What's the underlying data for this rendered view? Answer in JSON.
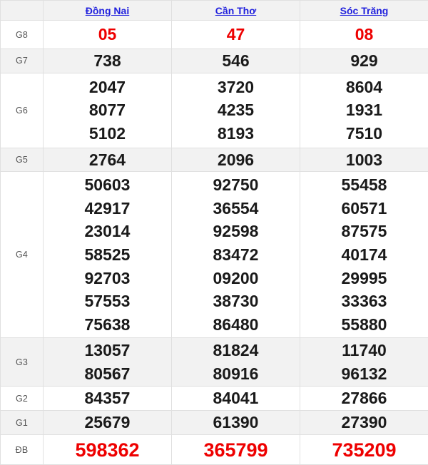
{
  "table": {
    "corner_label": "",
    "columns": [
      "Đồng Nai",
      "Cần Thơ",
      "Sóc Trăng"
    ],
    "colors": {
      "accent_red": "#ee0000",
      "link_blue": "#2222dd",
      "stripe_bg": "#f2f2f2",
      "plain_bg": "#ffffff",
      "border": "#e0e0e0",
      "number_black": "#1a1a1a",
      "label_gray": "#555555"
    },
    "rows": [
      {
        "label": "G8",
        "style": "plain",
        "accent": true,
        "size": "normal",
        "cells": [
          [
            "05"
          ],
          [
            "47"
          ],
          [
            "08"
          ]
        ]
      },
      {
        "label": "G7",
        "style": "stripe",
        "accent": false,
        "size": "normal",
        "cells": [
          [
            "738"
          ],
          [
            "546"
          ],
          [
            "929"
          ]
        ]
      },
      {
        "label": "G6",
        "style": "plain",
        "accent": false,
        "size": "normal",
        "cells": [
          [
            "2047",
            "8077",
            "5102"
          ],
          [
            "3720",
            "4235",
            "8193"
          ],
          [
            "8604",
            "1931",
            "7510"
          ]
        ]
      },
      {
        "label": "G5",
        "style": "stripe",
        "accent": false,
        "size": "normal",
        "cells": [
          [
            "2764"
          ],
          [
            "2096"
          ],
          [
            "1003"
          ]
        ]
      },
      {
        "label": "G4",
        "style": "plain",
        "accent": false,
        "size": "normal",
        "cells": [
          [
            "50603",
            "42917",
            "23014",
            "58525",
            "92703",
            "57553",
            "75638"
          ],
          [
            "92750",
            "36554",
            "92598",
            "83472",
            "09200",
            "38730",
            "86480"
          ],
          [
            "55458",
            "60571",
            "87575",
            "40174",
            "29995",
            "33363",
            "55880"
          ]
        ]
      },
      {
        "label": "G3",
        "style": "stripe",
        "accent": false,
        "size": "normal",
        "cells": [
          [
            "13057",
            "80567"
          ],
          [
            "81824",
            "80916"
          ],
          [
            "11740",
            "96132"
          ]
        ]
      },
      {
        "label": "G2",
        "style": "plain",
        "accent": false,
        "size": "normal",
        "cells": [
          [
            "84357"
          ],
          [
            "84041"
          ],
          [
            "27866"
          ]
        ]
      },
      {
        "label": "G1",
        "style": "stripe",
        "accent": false,
        "size": "normal",
        "cells": [
          [
            "25679"
          ],
          [
            "61390"
          ],
          [
            "27390"
          ]
        ]
      },
      {
        "label": "ĐB",
        "style": "plain",
        "accent": true,
        "size": "big",
        "cells": [
          [
            "598362"
          ],
          [
            "365799"
          ],
          [
            "735209"
          ]
        ]
      }
    ]
  }
}
